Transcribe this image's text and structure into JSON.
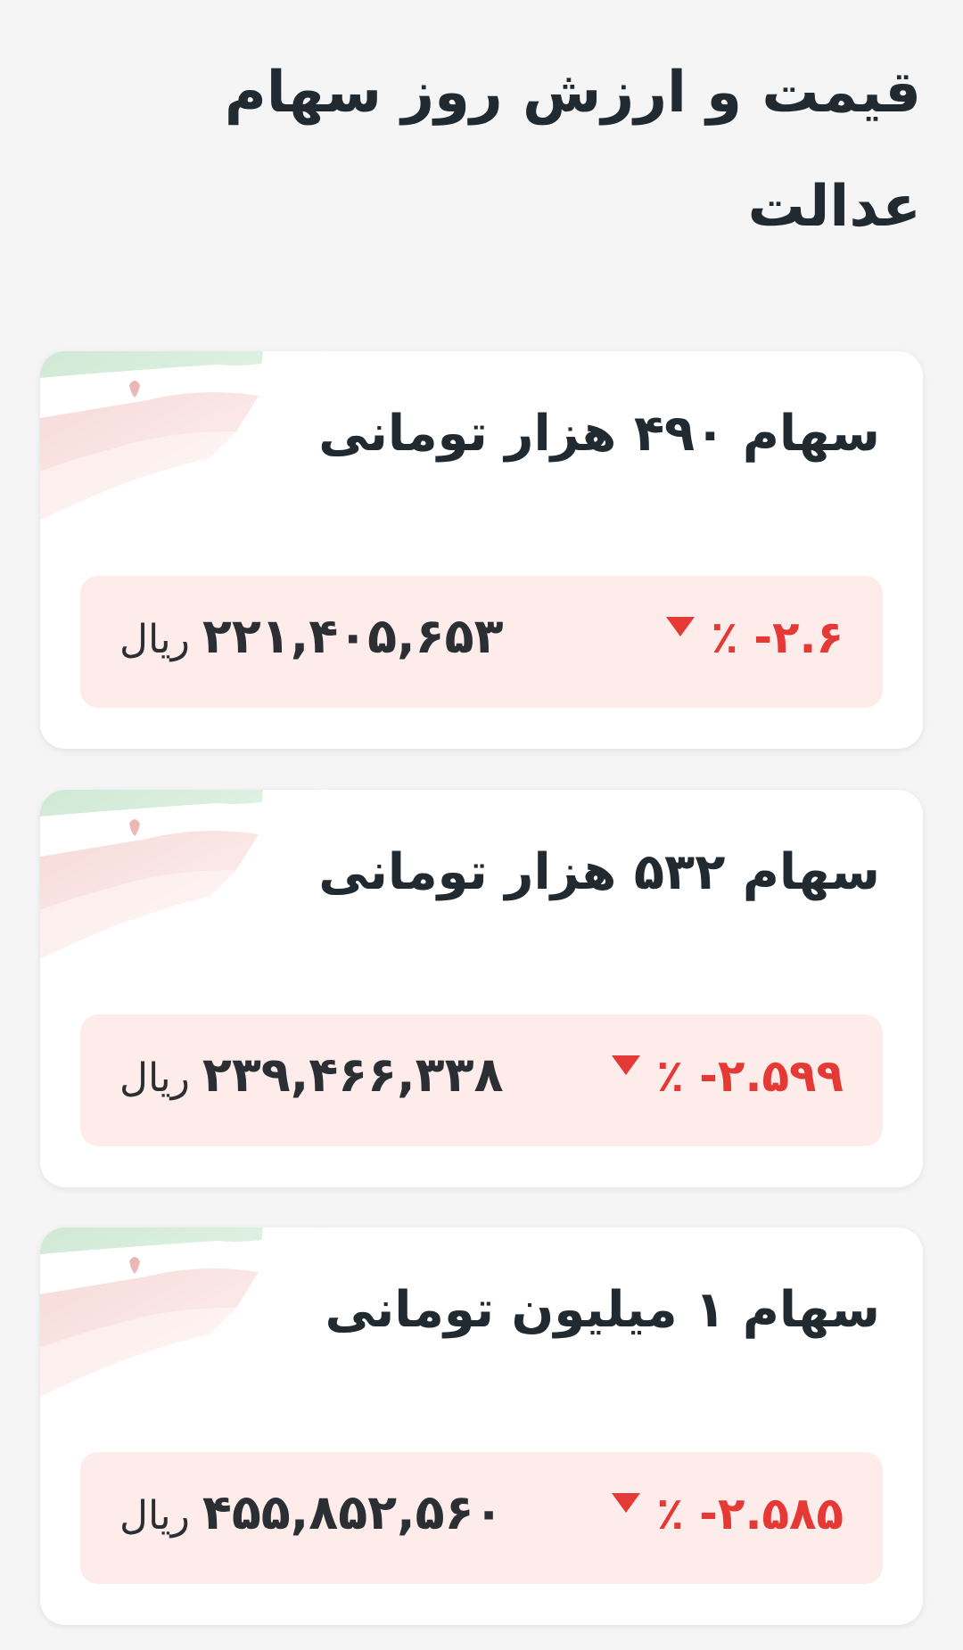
{
  "header": {
    "title": "قیمت و ارزش روز سهام عدالت"
  },
  "cards": [
    {
      "title": "سهام ۴۹۰ هزار تومانی",
      "change": "٪ -۲.۶",
      "change_direction": "down",
      "price": "۲۲۱,۴۰۵,۶۵۳",
      "unit": "ریال"
    },
    {
      "title": "سهام ۵۳۲ هزار تومانی",
      "change": "٪ -۲.۵۹۹",
      "change_direction": "down",
      "price": "۲۳۹,۴۶۶,۳۳۸",
      "unit": "ریال"
    },
    {
      "title": "سهام ۱ میلیون تومانی",
      "change": "٪ -۲.۵۸۵",
      "change_direction": "down",
      "price": "۴۵۵,۸۵۲,۵۶۰",
      "unit": "ریال"
    }
  ],
  "colors": {
    "background": "#f5f5f5",
    "card": "#ffffff",
    "price_box": "#fdecea",
    "negative": "#e53935",
    "text": "#212a30"
  },
  "icons": {
    "flag": "iran-flag-icon",
    "trend": "triangle-down-icon"
  }
}
